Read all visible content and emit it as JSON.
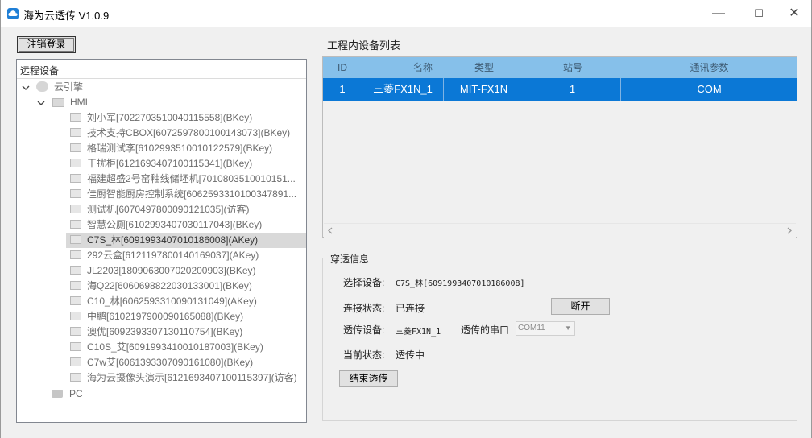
{
  "window": {
    "title": "海为云透传 V1.0.9",
    "minimize": "—",
    "maximize": "☐",
    "close": "✕"
  },
  "logout_button": "注销登录",
  "tree": {
    "header": "远程设备",
    "cloud_engine": "云引擎",
    "hmi": "HMI",
    "pc": "PC",
    "devices": [
      "刘小军[7022703510040115558](BKey)",
      "技术支持CBOX[6072597800100143073](BKey)",
      "格瑞测试李[6102993510010122579](BKey)",
      "干扰柜[6121693407100115341](BKey)",
      "福建超盛2号窑釉线储坯机[70108035100101​51...",
      "佳厨智能厨房控制系统[60625933101003478​91...",
      "测试机[6070497800090121035](访客)",
      "智慧公厕[6102993407030117043](BKey)",
      "C7S_林[6091993407010186008](AKey)",
      "292云盒[6121197800140169037](AKey)",
      "JL2203[1809063007020200903](BKey)",
      "海Q22[6060698822030133001](BKey)",
      "C10_林[6062593310090131049](AKey)",
      "中鹏[6102197900090165088](BKey)",
      "澳优[6092393307130110754](BKey)",
      "C10S_艾[6091993410010187003](BKey)",
      "C7w艾[6061393307090161080](BKey)",
      "海为云摄像头演示[6121693407100115397](访客)"
    ],
    "selected_index": 8
  },
  "device_list": {
    "title": "工程内设备列表",
    "columns": [
      "ID",
      "名称",
      "类型",
      "站号",
      "通讯参数"
    ],
    "rows": [
      [
        "1",
        "三菱FX1N_1",
        "MIT-FX1N",
        "1",
        "COM"
      ]
    ]
  },
  "passthrough": {
    "group_title": "穿透信息",
    "select_device_label": "选择设备:",
    "select_device_value": "C7S_林[6091993407010186008]",
    "conn_status_label": "连接状态:",
    "conn_status_value": "已连接",
    "disconnect_button": "断开",
    "pt_device_label": "透传设备:",
    "pt_device_value": "三菱FX1N_1",
    "pt_port_label": "透传的串口",
    "pt_port_value": "COM11",
    "current_status_label": "当前状态:",
    "current_status_value": "透传中",
    "end_button": "结束透传"
  },
  "colors": {
    "header_blue": "#86c0ea",
    "selected_row_blue": "#0b78d6",
    "app_icon": "#1f7fd6"
  }
}
